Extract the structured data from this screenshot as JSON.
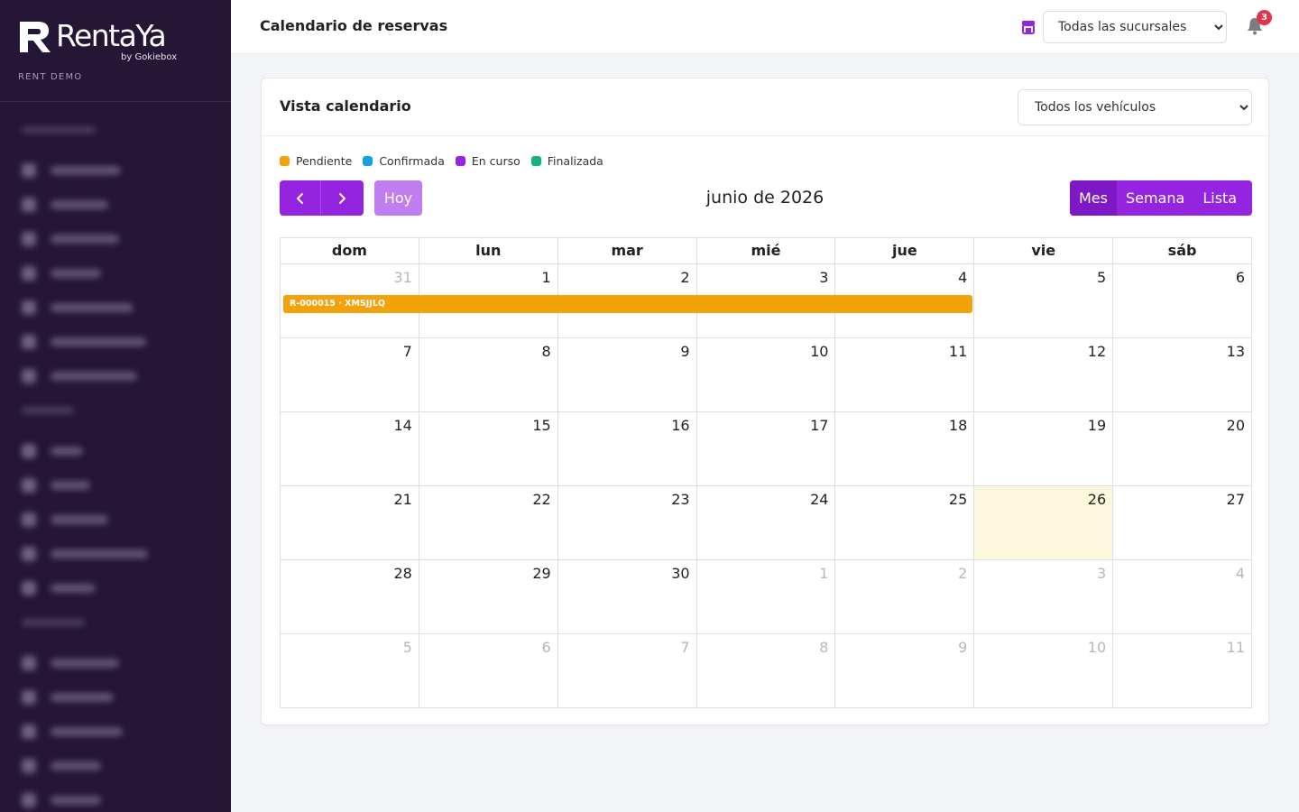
{
  "brand": {
    "name": "RentaYa",
    "byline": "by Gokiebox",
    "workspace": "RENT DEMO"
  },
  "sidebar": {
    "sections": [
      {
        "items": 7
      },
      {
        "items": 5
      },
      {
        "items": 6
      }
    ]
  },
  "header": {
    "title": "Calendario de reservas",
    "branch_select": {
      "value": "Todas las sucursales"
    },
    "notifications_count": "3"
  },
  "calendar": {
    "card_title": "Vista calendario",
    "vehicle_select": {
      "value": "Todos los vehículos"
    },
    "legend": [
      {
        "label": "Pendiente",
        "color": "#f4a20c"
      },
      {
        "label": "Confirmada",
        "color": "#14a1e0"
      },
      {
        "label": "En curso",
        "color": "#9424e0"
      },
      {
        "label": "Finalizada",
        "color": "#14b47a"
      }
    ],
    "prev_icon": "chevron-left-icon",
    "next_icon": "chevron-right-icon",
    "today_label": "Hoy",
    "month_title": "junio de 2026",
    "views": [
      "Mes",
      "Semana",
      "Lista"
    ],
    "active_view": "Mes",
    "weekdays": [
      "dom",
      "lun",
      "mar",
      "mié",
      "jue",
      "vie",
      "sáb"
    ],
    "weeks": [
      [
        "31",
        "1",
        "2",
        "3",
        "4",
        "5",
        "6"
      ],
      [
        "7",
        "8",
        "9",
        "10",
        "11",
        "12",
        "13"
      ],
      [
        "14",
        "15",
        "16",
        "17",
        "18",
        "19",
        "20"
      ],
      [
        "21",
        "22",
        "23",
        "24",
        "25",
        "26",
        "27"
      ],
      [
        "28",
        "29",
        "30",
        "1",
        "2",
        "3",
        "4"
      ],
      [
        "5",
        "6",
        "7",
        "8",
        "9",
        "10",
        "11"
      ]
    ],
    "today": "26",
    "events": [
      {
        "label": "R-000015 · XMSJJLQ",
        "status": "Pendiente",
        "start": "31",
        "end": "4"
      }
    ]
  },
  "colors": {
    "sidebar_bg": "#241634",
    "accent": "#9424e0",
    "today_bg": "#fdf8dd"
  }
}
